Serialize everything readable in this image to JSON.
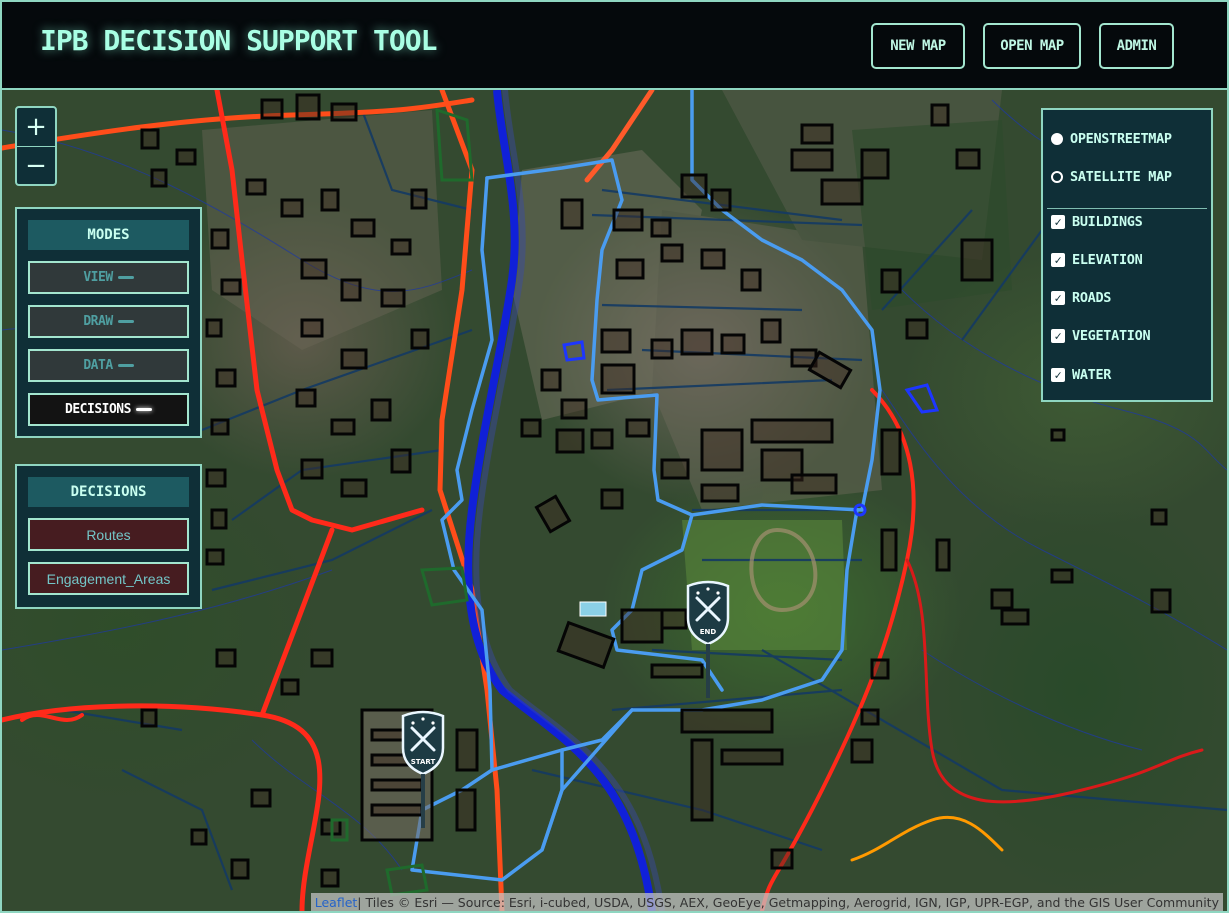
{
  "header": {
    "title": "IPB DECISION SUPPORT TOOL",
    "buttons": {
      "new_map": "NEW MAP",
      "open_map": "OPEN MAP",
      "admin": "ADMIN"
    }
  },
  "zoom": {
    "in": "+",
    "out": "−"
  },
  "modes_panel": {
    "title": "MODES",
    "items": [
      {
        "label": "VIEW",
        "active": false
      },
      {
        "label": "DRAW",
        "active": false
      },
      {
        "label": "DATA",
        "active": false
      },
      {
        "label": "DECISIONS",
        "active": true
      }
    ]
  },
  "decisions_panel": {
    "title": "DECISIONS",
    "items": [
      {
        "label": "Routes"
      },
      {
        "label": "Engagement_Areas"
      }
    ]
  },
  "layers": {
    "base": [
      {
        "label": "OPENSTREETMAP",
        "selected": true
      },
      {
        "label": "SATELLITE MAP",
        "selected": false
      }
    ],
    "overlays": [
      {
        "label": "BUILDINGS",
        "checked": true
      },
      {
        "label": "ELEVATION",
        "checked": true
      },
      {
        "label": "ROADS",
        "checked": true
      },
      {
        "label": "VEGETATION",
        "checked": true
      },
      {
        "label": "WATER",
        "checked": true
      }
    ],
    "check_glyph": "✓"
  },
  "markers": {
    "start": "START",
    "end": "END"
  },
  "attribution": {
    "link": "Leaflet",
    "text": " | Tiles © Esri — Source: Esri, i-cubed, USDA, USGS, AEX, GeoEye, Getmapping, Aerogrid, IGN, IGP, UPR-EGP, and the GIS User Community"
  },
  "colors": {
    "accent": "#8fd6c1",
    "panel": "#0f2f37",
    "route": "#4a9cf0",
    "river": "#1020d8",
    "major_road": "#ff2a1a",
    "decision_button": "#461c20"
  }
}
